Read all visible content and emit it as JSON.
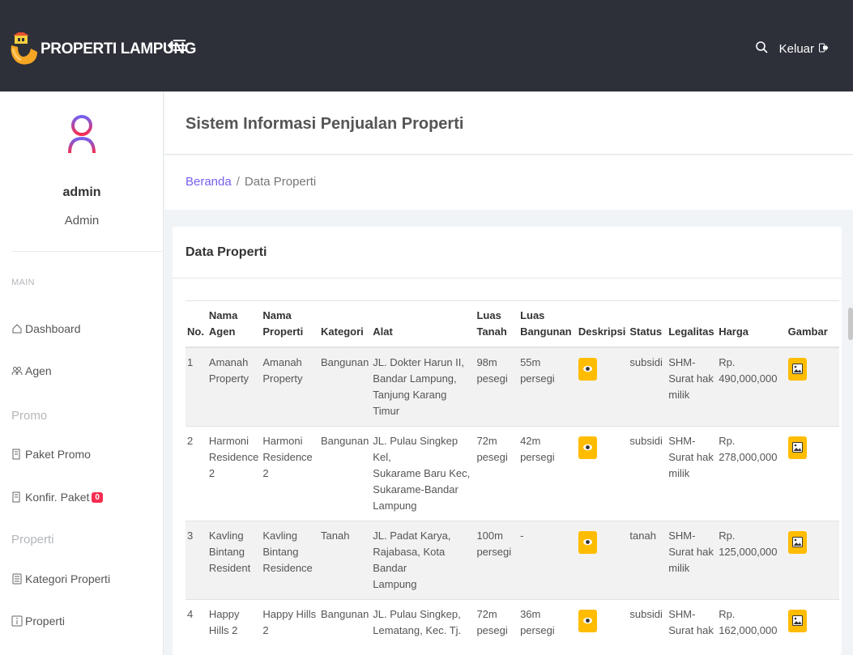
{
  "brand": {
    "title": "PROPERTI LAMPUNG"
  },
  "topbar": {
    "logout_label": "Keluar"
  },
  "user": {
    "name": "admin",
    "role": "Admin"
  },
  "sidebar": {
    "main_label": "MAIN",
    "items": [
      {
        "label": "Dashboard",
        "icon": "home-icon"
      },
      {
        "label": "Agen",
        "icon": "users-icon"
      }
    ],
    "promo_label": "Promo",
    "promo_items": [
      {
        "label": "Paket Promo",
        "icon": "document-icon"
      },
      {
        "label": "Konfir. Paket",
        "icon": "document-icon",
        "badge": "0"
      }
    ],
    "properti_label": "Properti",
    "properti_items": [
      {
        "label": "Kategori Properti",
        "icon": "list-icon"
      },
      {
        "label": "Properti",
        "icon": "info-icon"
      }
    ]
  },
  "page": {
    "title": "Sistem Informasi Penjualan Properti"
  },
  "breadcrumb": {
    "home": "Beranda",
    "current": "Data Properti"
  },
  "card": {
    "title": "Data Properti"
  },
  "table": {
    "headers": {
      "no": "No.",
      "agen": [
        "Nama",
        "Agen"
      ],
      "properti": [
        "Nama",
        "Properti"
      ],
      "kategori": "Kategori",
      "alat": "Alat",
      "tanah": [
        "Luas",
        "Tanah"
      ],
      "bangunan": [
        "Luas",
        "Bangunan"
      ],
      "deskripsi": "Deskripsi",
      "status": "Status",
      "legalitas": "Legalitas",
      "harga": "Harga",
      "gambar": "Gambar"
    },
    "rows": [
      {
        "no": "1",
        "agen": [
          "Amanah",
          "Property"
        ],
        "properti": [
          "Amanah",
          "Property"
        ],
        "kategori": "Bangunan",
        "alat": [
          "JL. Dokter Harun II,",
          "Bandar Lampung,",
          "Tanjung Karang Timur"
        ],
        "tanah": [
          "98m",
          "pesegi"
        ],
        "bangunan": [
          "55m",
          "persegi"
        ],
        "status": "subsidi",
        "legalitas": [
          "SHM-",
          "Surat hak",
          "milik"
        ],
        "harga": [
          "Rp.",
          "490,000,000"
        ]
      },
      {
        "no": "2",
        "agen": [
          "Harmoni",
          "Residence",
          "2"
        ],
        "properti": [
          "Harmoni",
          "Residence",
          "2"
        ],
        "kategori": "Bangunan",
        "alat": [
          "JL. Pulau Singkep Kel,",
          "Sukarame Baru Kec,",
          "Sukarame-Bandar",
          "Lampung"
        ],
        "tanah": [
          "72m",
          "pesegi"
        ],
        "bangunan": [
          "42m",
          "persegi"
        ],
        "status": "subsidi",
        "legalitas": [
          "SHM-",
          "Surat hak",
          "milik"
        ],
        "harga": [
          "Rp.",
          "278,000,000"
        ]
      },
      {
        "no": "3",
        "agen": [
          "Kavling",
          "Bintang",
          "Resident"
        ],
        "properti": [
          "Kavling",
          "Bintang",
          "Residence"
        ],
        "kategori": "Tanah",
        "alat": [
          "JL. Padat Karya,",
          "Rajabasa, Kota Bandar",
          "Lampung"
        ],
        "tanah": [
          "100m",
          "persegi"
        ],
        "bangunan": [
          "-"
        ],
        "status": "tanah",
        "legalitas": [
          "SHM-",
          "Surat hak",
          "milik"
        ],
        "harga": [
          "Rp.",
          "125,000,000"
        ]
      },
      {
        "no": "4",
        "agen": [
          "Happy",
          "Hills 2"
        ],
        "properti": [
          "Happy Hills",
          "2"
        ],
        "kategori": "Bangunan",
        "alat": [
          "JL. Pulau Singkep,",
          "Lematang, Kec. Tj."
        ],
        "tanah": [
          "72m",
          "pesegi"
        ],
        "bangunan": [
          "36m",
          "persegi"
        ],
        "status": "subsidi",
        "legalitas": [
          "SHM-",
          "Surat hak"
        ],
        "harga": [
          "Rp.",
          "162,000,000"
        ]
      }
    ]
  }
}
